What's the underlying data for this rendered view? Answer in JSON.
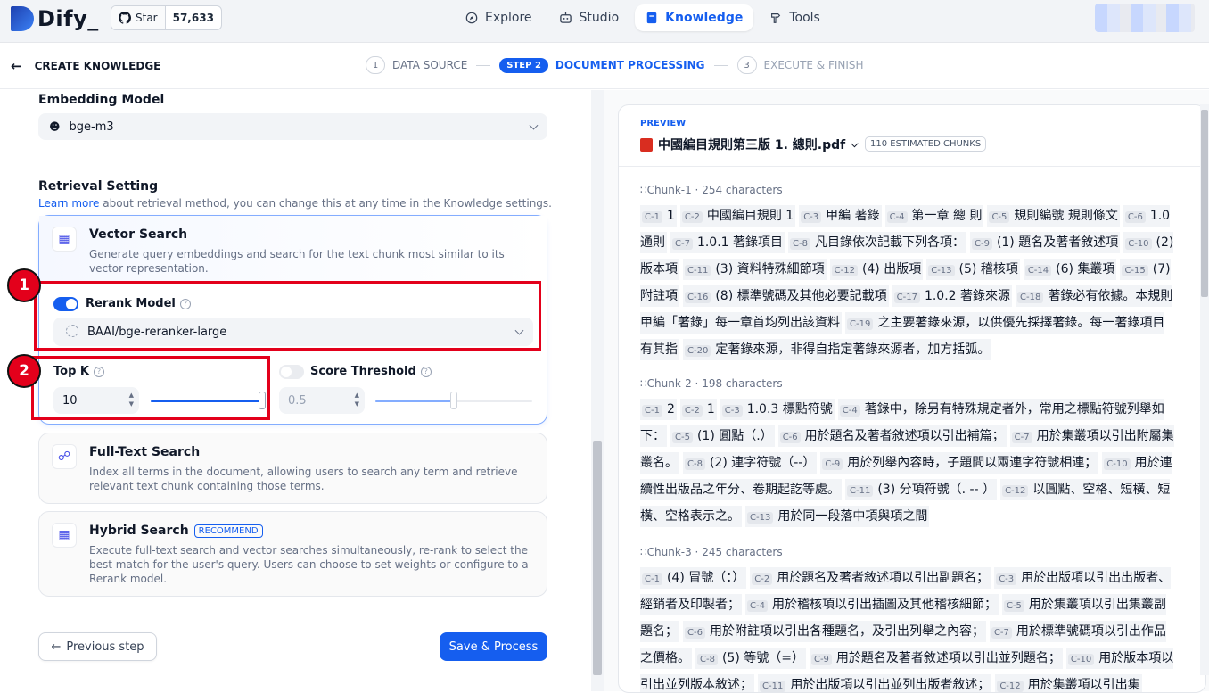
{
  "brand": {
    "name": "Dify_"
  },
  "github": {
    "label": "Star",
    "count": "57,633"
  },
  "nav": {
    "explore": "Explore",
    "studio": "Studio",
    "knowledge": "Knowledge",
    "tools": "Tools"
  },
  "header": {
    "back_title": "CREATE KNOWLEDGE"
  },
  "steps": {
    "s1": {
      "num": "1",
      "label": "DATA SOURCE"
    },
    "s2": {
      "num": "STEP 2",
      "label": "DOCUMENT PROCESSING"
    },
    "s3": {
      "num": "3",
      "label": "EXECUTE & FINISH"
    }
  },
  "embedding": {
    "title": "Embedding Model",
    "value": "bge-m3"
  },
  "retrieval": {
    "title": "Retrieval Setting",
    "learn_more": "Learn more",
    "subtitle": " about retrieval method, you can change this at any time in the Knowledge settings."
  },
  "vector": {
    "title": "Vector Search",
    "desc": "Generate query embeddings and search for the text chunk most similar to its vector representation.",
    "rerank_label": "Rerank Model",
    "rerank_enabled": true,
    "rerank_model": "BAAI/bge-reranker-large",
    "topk_label": "Top K",
    "topk_value": "10",
    "topk_level": 1.0,
    "score_label": "Score Threshold",
    "score_enabled": false,
    "score_value": "0.5",
    "score_level": 0.5
  },
  "fulltext": {
    "title": "Full-Text Search",
    "desc": "Index all terms in the document, allowing users to search any term and retrieve relevant text chunk containing those terms."
  },
  "hybrid": {
    "title": "Hybrid Search",
    "badge": "RECOMMEND",
    "desc": "Execute full-text search and vector searches simultaneously, re-rank to select the best match for the user's query. Users can choose to set weights or configure to a Rerank model."
  },
  "annotations": {
    "m1": "1",
    "m2": "2"
  },
  "buttons": {
    "prev": "Previous step",
    "save": "Save & Process"
  },
  "preview": {
    "tag": "PREVIEW",
    "file": "中國編目規則第三版 1. 總則.pdf",
    "chunks_badge": "110 ESTIMATED CHUNKS",
    "chunks": [
      {
        "name": "Chunk-1",
        "meta": "254 characters",
        "segs": [
          {
            "id": "C-1",
            "text": "1"
          },
          {
            "id": "C-2",
            "text": "中國編目規則 1"
          },
          {
            "id": "C-3",
            "text": "甲編 著錄"
          },
          {
            "id": "C-4",
            "text": "第一章 總 則"
          },
          {
            "id": "C-5",
            "text": "規則編號 規則條文"
          },
          {
            "id": "C-6",
            "text": "1.0 通則"
          },
          {
            "id": "C-7",
            "text": "1.0.1 著錄項目"
          },
          {
            "id": "C-8",
            "text": "凡目錄依次記載下列各項："
          },
          {
            "id": "C-9",
            "text": "(1) 題名及著者敘述項"
          },
          {
            "id": "C-10",
            "text": "(2) 版本項"
          },
          {
            "id": "C-11",
            "text": "(3) 資料特殊細節項"
          },
          {
            "id": "C-12",
            "text": "(4) 出版項"
          },
          {
            "id": "C-13",
            "text": "(5) 稽核項"
          },
          {
            "id": "C-14",
            "text": "(6) 集叢項"
          },
          {
            "id": "C-15",
            "text": "(7) 附註項"
          },
          {
            "id": "C-16",
            "text": "(8) 標準號碼及其他必要記載項"
          },
          {
            "id": "C-17",
            "text": "1.0.2 著錄來源"
          },
          {
            "id": "C-18",
            "text": "著錄必有依據。本規則甲編「著錄」每一章首均列出該資料"
          },
          {
            "id": "C-19",
            "text": "之主要著錄來源，以供優先採擇著錄。每一著錄項目有其指"
          },
          {
            "id": "C-20",
            "text": "定著錄來源，非得自指定著錄來源者，加方括弧。"
          }
        ]
      },
      {
        "name": "Chunk-2",
        "meta": "198 characters",
        "segs": [
          {
            "id": "C-1",
            "text": "2"
          },
          {
            "id": "C-2",
            "text": "1"
          },
          {
            "id": "C-3",
            "text": "1.0.3 標點符號"
          },
          {
            "id": "C-4",
            "text": "著錄中，除另有特殊規定者外，常用之標點符號列舉如下："
          },
          {
            "id": "C-5",
            "text": "(1) 圓點（.）"
          },
          {
            "id": "C-6",
            "text": "用於題名及著者敘述項以引出補篇；"
          },
          {
            "id": "C-7",
            "text": "用於集叢項以引出附屬集叢名。"
          },
          {
            "id": "C-8",
            "text": "(2) 連字符號（--）"
          },
          {
            "id": "C-9",
            "text": "用於列舉內容時，子題間以兩連字符號相連；"
          },
          {
            "id": "C-10",
            "text": "用於連續性出版品之年分、卷期起訖等處。"
          },
          {
            "id": "C-11",
            "text": "(3) 分項符號（. -- ）"
          },
          {
            "id": "C-12",
            "text": "以圓點、空格、短橫、短橫、空格表示之。"
          },
          {
            "id": "C-13",
            "text": "用於同一段落中項與項之間"
          }
        ]
      },
      {
        "name": "Chunk-3",
        "meta": "245 characters",
        "segs": [
          {
            "id": "C-1",
            "text": "(4) 冒號（：）"
          },
          {
            "id": "C-2",
            "text": "用於題名及著者敘述項以引出副題名；"
          },
          {
            "id": "C-3",
            "text": "用於出版項以引出出版者、經銷者及印製者；"
          },
          {
            "id": "C-4",
            "text": "用於稽核項以引出插圖及其他稽核細節；"
          },
          {
            "id": "C-5",
            "text": "用於集叢項以引出集叢副題名；"
          },
          {
            "id": "C-6",
            "text": "用於附註項以引出各種題名，及引出列舉之內容；"
          },
          {
            "id": "C-7",
            "text": "用於標準號碼項以引出作品之價格。"
          },
          {
            "id": "C-8",
            "text": "(5) 等號（=）"
          },
          {
            "id": "C-9",
            "text": "用於題名及著者敘述項以引出並列題名；"
          },
          {
            "id": "C-10",
            "text": "用於版本項以引出並列版本敘述；"
          },
          {
            "id": "C-11",
            "text": "用於出版項以引出並列出版者敘述；"
          },
          {
            "id": "C-12",
            "text": "用於集叢項以引出集"
          }
        ]
      }
    ]
  }
}
